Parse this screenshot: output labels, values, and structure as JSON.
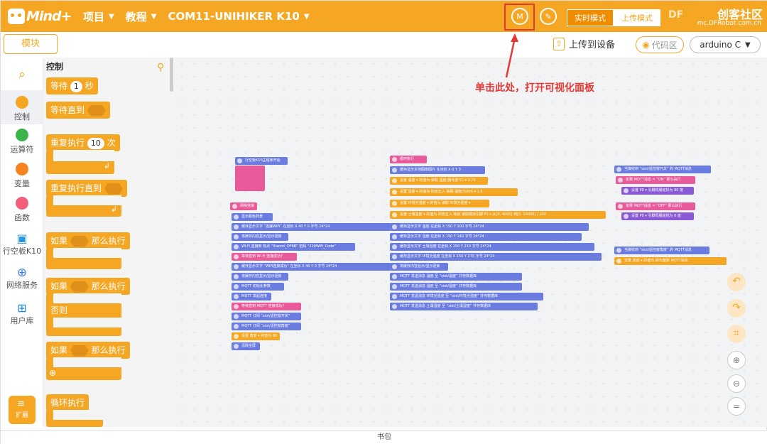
{
  "topbar": {
    "logo_text": "Mind+",
    "menus": [
      {
        "label": "项目"
      },
      {
        "label": "教程"
      },
      {
        "label": "COM11-UNIHIKER K10"
      }
    ],
    "mode_realtime": "实时模式",
    "mode_upload": "上传模式",
    "brand_text": "创客社区",
    "brand_sub": "mc.DFRobot.com.cn",
    "brand_prefix": "DF"
  },
  "subbar": {
    "modules_tab": "模块",
    "upload_label": "上传到设备",
    "code_label": "代码区",
    "language": "arduino C"
  },
  "categories": [
    {
      "label": "",
      "color": "",
      "icon": "search-icon"
    },
    {
      "label": "控制",
      "color": "#f5a623"
    },
    {
      "label": "运算符",
      "color": "#3cb44b"
    },
    {
      "label": "变量",
      "color": "#f5841f"
    },
    {
      "label": "函数",
      "color": "#f25f7a"
    },
    {
      "label": "行空板K10",
      "color": "#2196f3"
    },
    {
      "label": "网络服务",
      "color": "#3f7fe0"
    },
    {
      "label": "用户库",
      "color": "#1e88e5"
    }
  ],
  "extension_label": "扩展",
  "palette": {
    "title": "控制",
    "wait_prefix": "等待",
    "wait_value": "1",
    "wait_unit": "秒",
    "wait_until": "等待直到",
    "repeat_prefix": "重复执行",
    "repeat_value": "10",
    "repeat_unit": "次",
    "repeat_until": "重复执行直到",
    "if_then_1_prefix": "如果",
    "if_then_1_suffix": "那么执行",
    "if_else_prefix": "如果",
    "if_else_suffix": "那么执行",
    "else_label": "否则",
    "if_then_2_prefix": "如果",
    "if_then_2_suffix": "那么执行",
    "loop_label": "循环执行"
  },
  "annotation": "单击此处，打开可视化面板",
  "bottom_label": "书包",
  "canvas_blocks": {
    "col1_header": [
      "行空板K10主程序开始"
    ],
    "col1": [
      "网络连接",
      "显示颜色背景",
      "缓存显示文字 “连接WiFi” 在坐标 X 40 Y 0 字号 24*24",
      "将缓存内容显示/显示更新",
      "Wi-Fi 连接到 热点 “Xiaomi_DF6B” 密码 “220WiFi_Code”",
      "等待直到 Wi-Fi 连接成功?",
      "缓存显示文字 “WiFi连接成功” 在坐标 X 40 Y 0 字号 24*24",
      "将缓存内容显示/显示更新",
      "MQTT 初始化参数",
      "MQTT 发起连接",
      "等待直到 MQTT 连接成功?",
      "MQTT 订阅 “siot/遥控窗开关”",
      "MQTT 订阅 “siot/遥控窗角度”",
      "设置 角度 ▾ 的值为 90",
      "清除全屏"
    ],
    "col2_header": "循环执行",
    "col2": [
      "缓存显示本地图像图片 在坐标 X 0 Y 0",
      "设置 温度 ▾ 的值为 读取 温度(摄氏度℃) ▾ 0.75",
      "设置 湿度 ▾ 的值为 四舍五入 读取 湿度(%RH) ▾ 1.6",
      "设置 环境光强度 ▾ 的值为 读取 环境光强度 ▾",
      "设置 土壤湿度 ▾ 的值为 四舍五入 映射 读取模拟引脚 P1 ▾ 从[0, 4095] 到[0, 10000] / 100",
      "缓存显示文字 温度 在坐标 X 150 Y 100 字号 24*24",
      "缓存显示文字 湿度 在坐标 X 150 Y 140 字号 24*24",
      "缓存显示文字 土壤湿度 在坐标 X 150 Y 210 字号 24*24",
      "缓存显示文字 环境光强度 在坐标 X 150 Y 270 字号 24*24",
      "将缓存内容显示/显示更新",
      "MQTT 发送消息 温度 至 “siot/温度” 并存数据库",
      "MQTT 发送消息 湿度 至 “siot/湿度” 并存数据库",
      "MQTT 发送消息 环境光强度 至 “siot/环境光强度” 并存数据库",
      "MQTT 发送消息 土壤湿度 至 “siot/土壤湿度” 并存数据库"
    ],
    "col3a": [
      "当接收到 “siot/遥控窗开关” 的 MQTT消息",
      "如果 MQTT消息 = “ON” 那么执行",
      "设置 P0 ▾ 引脚伺服舵机为 90 度",
      "如果 MQTT消息 = “OFF” 那么执行",
      "设置 P0 ▾ 引脚伺服舵机为 0 度"
    ],
    "col3b": [
      "当接收到 “siot/遥控窗角度” 的 MQTT消息",
      "设置 角度 ▾ 的值为 转为整数 MQTT消息"
    ]
  }
}
